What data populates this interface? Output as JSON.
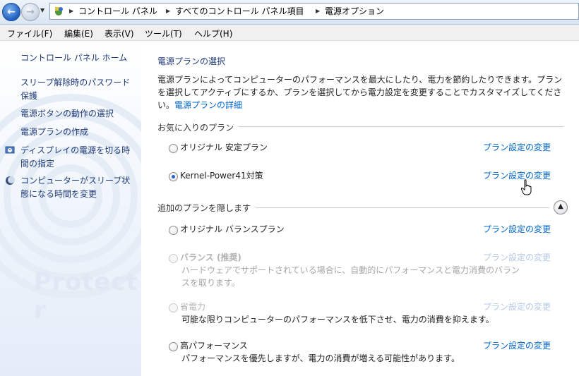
{
  "breadcrumb": {
    "items": [
      "コントロール パネル",
      "すべてのコントロール パネル項目",
      "電源オプション"
    ]
  },
  "menu": [
    "ファイル(F)",
    "編集(E)",
    "表示(V)",
    "ツール(T)",
    "ヘルプ(H)"
  ],
  "sidebar": {
    "home": "コントロール パネル ホーム",
    "items": [
      {
        "line1": "スリープ解除時のパスワード",
        "line2": "保護"
      },
      {
        "line1": "電源ボタンの動作の選択",
        "line2": ""
      },
      {
        "line1": "電源プランの作成",
        "line2": ""
      },
      {
        "line1": "ディスプレイの電源を切る時",
        "line2": "間の指定"
      },
      {
        "line1": "コンピューターがスリープ状",
        "line2": "態になる時間を変更"
      }
    ],
    "watermark": "Protect r"
  },
  "main": {
    "title": "電源プランの選択",
    "description_line1": "電源プランによってコンピューターのパフォーマンスを最大にしたり、電力を節約したりできます。プラン",
    "description_line2": "を選択してアクティブにするか、プランを選択してから電力設定を変更することでカスタマイズしてくださ",
    "description_line3_prefix": "い。",
    "description_link": "電源プランの詳細",
    "favorites_header": "お気に入りのプラン",
    "hidden_header": "追加のプランを隠します",
    "change_label": "プラン設定の変更",
    "plans": [
      {
        "name": "オリジナル 安定プラン",
        "selected": false,
        "disabled": false,
        "desc": ""
      },
      {
        "name": "Kernel-Power41対策",
        "selected": true,
        "disabled": false,
        "desc": ""
      },
      {
        "name": "オリジナル バランスプラン",
        "selected": false,
        "disabled": false,
        "desc": ""
      },
      {
        "name": "バランス (推奨)",
        "selected": false,
        "disabled": true,
        "desc1": "ハードウェアでサポートされている場合に、自動的にパフォーマンスと電力消費のバラン",
        "desc2": "スを取ります。"
      },
      {
        "name": "省電力",
        "selected": false,
        "disabled": true,
        "desc1": "可能な限りコンピューターのパフォーマンスを低下させ、電力の消費を抑えます。"
      },
      {
        "name": "高パフォーマンス",
        "selected": false,
        "disabled": false,
        "desc1": "パフォーマンスを優先しますが、電力の消費が増える可能性があります。"
      }
    ]
  },
  "colors": {
    "link": "#0066cc",
    "nav": "#1f3a78",
    "disabled_link": "#b4c9e6"
  }
}
